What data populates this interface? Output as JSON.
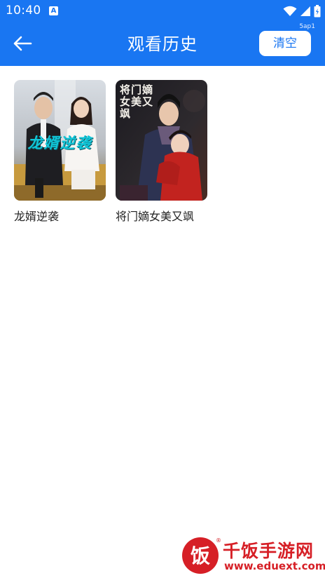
{
  "status_bar": {
    "time": "10:40",
    "notification_icon": "a-icon",
    "icons": [
      "wifi-icon",
      "signal-icon",
      "battery-icon"
    ]
  },
  "app_bar": {
    "title": "观看历史",
    "back_icon": "arrow-left-icon",
    "clear_label": "清空",
    "build_tag": "5ap1"
  },
  "history": [
    {
      "title": "龙婿逆袭",
      "poster_caption": "龙婿逆袭"
    },
    {
      "title": "将门嫡女美又飒",
      "poster_caption": "将门嫡女美又飒"
    }
  ],
  "watermark": {
    "logo_text": "饭",
    "name": "千饭手游网",
    "url": "www.eduext.com"
  },
  "colors": {
    "primary": "#1976f2",
    "watermark": "#d61f26"
  }
}
